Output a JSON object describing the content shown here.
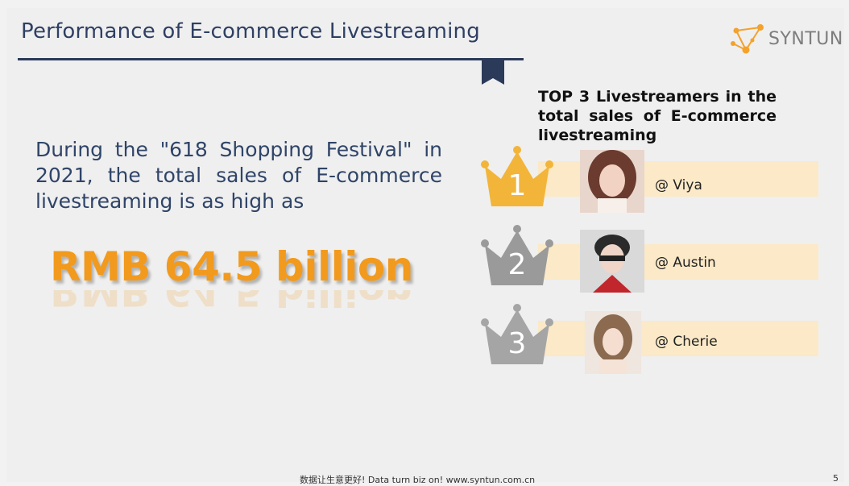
{
  "slide": {
    "title": "Performance of E-commerce Livestreaming",
    "brand": "SYNTUN",
    "intro_text": "During the \"618 Shopping Festival\" in 2021, the total sales of E-commerce livestreaming is as high as",
    "highlight_figure": "RMB 64.5 billion",
    "top3_heading": "TOP 3 Livestreamers in the total sales of E-commerce livestreaming",
    "rankings": [
      {
        "rank": "1",
        "handle": "@ Viya",
        "crown_color": "#f2b53a"
      },
      {
        "rank": "2",
        "handle": "@ Austin",
        "crown_color": "#9a9a9a"
      },
      {
        "rank": "3",
        "handle": "@ Cherie",
        "crown_color": "#a5a5a5"
      }
    ],
    "footer": "数据让生意更好! Data turn biz on! www.syntun.com.cn",
    "page_number": "5"
  },
  "colors": {
    "title": "#2f3f63",
    "accent_orange": "#f29a1d",
    "rank_bar": "#fbe9c7",
    "gold": "#f2b53a",
    "silver": "#9a9a9a"
  }
}
